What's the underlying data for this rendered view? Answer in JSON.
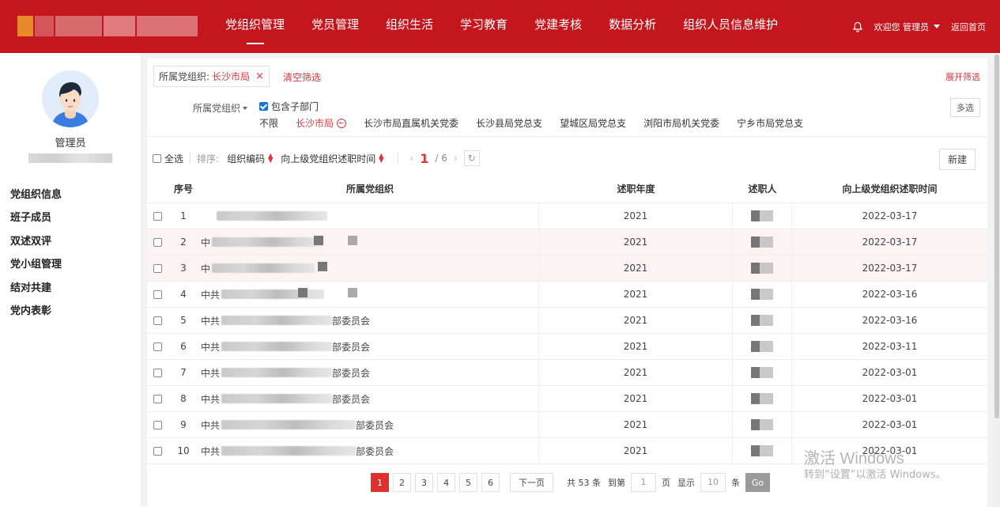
{
  "nav": {
    "items": [
      "党组织管理",
      "党员管理",
      "组织生活",
      "学习教育",
      "党建考核",
      "数据分析",
      "组织人员信息维护"
    ],
    "active_index": 0,
    "welcome": "欢迎您 管理员",
    "home": "返回首页"
  },
  "sidebar": {
    "user_name": "管理员",
    "menu": [
      "党组织信息",
      "班子成员",
      "双述双评",
      "党小组管理",
      "结对共建",
      "党内表彰"
    ]
  },
  "filter": {
    "tag_label": "所属党组织:",
    "tag_value": "长沙市局",
    "tag_close": "×",
    "clear": "清空筛选",
    "expand": "展开筛选",
    "org_label": "所属党组织",
    "include_sub": "包含子部门",
    "options": [
      "不限",
      "长沙市局",
      "长沙市局直属机关党委",
      "长沙县局党总支",
      "望城区局党总支",
      "浏阳市局机关党委",
      "宁乡市局党总支"
    ],
    "selected_option": "长沙市局",
    "multi": "多选"
  },
  "toolbar": {
    "select_all": "全选",
    "sort_label": "排序:",
    "sort_keys": [
      "组织编码",
      "向上级党组织述职时间"
    ],
    "current_page": "1",
    "total_pages": "/ 6",
    "new": "新建"
  },
  "table": {
    "headers": {
      "index": "序号",
      "org": "所属党组织",
      "year": "述职年度",
      "person": "述职人",
      "time": "向上级党组织述职时间"
    },
    "rows": [
      {
        "index": "1",
        "org_prefix": "",
        "org_suffix": "",
        "year": "2021",
        "time": "2022-03-17"
      },
      {
        "index": "2",
        "org_prefix": "中",
        "org_suffix": "",
        "year": "2021",
        "time": "2022-03-17"
      },
      {
        "index": "3",
        "org_prefix": "中",
        "org_suffix": "",
        "year": "2021",
        "time": "2022-03-17"
      },
      {
        "index": "4",
        "org_prefix": "中共",
        "org_suffix": "",
        "year": "2021",
        "time": "2022-03-16"
      },
      {
        "index": "5",
        "org_prefix": "中共",
        "org_suffix": "部委员会",
        "year": "2021",
        "time": "2022-03-16"
      },
      {
        "index": "6",
        "org_prefix": "中共",
        "org_suffix": "部委员会",
        "year": "2021",
        "time": "2022-03-11"
      },
      {
        "index": "7",
        "org_prefix": "中共",
        "org_suffix": "部委员会",
        "year": "2021",
        "time": "2022-03-01"
      },
      {
        "index": "8",
        "org_prefix": "中共",
        "org_suffix": "部委员会",
        "year": "2021",
        "time": "2022-03-01"
      },
      {
        "index": "9",
        "org_prefix": "中共",
        "org_suffix": "部委员会",
        "year": "2021",
        "time": "2022-03-01"
      },
      {
        "index": "10",
        "org_prefix": "中共",
        "org_suffix": "部委员会",
        "year": "2021",
        "time": "2022-03-01"
      }
    ]
  },
  "pagination": {
    "pages": [
      "1",
      "2",
      "3",
      "4",
      "5",
      "6"
    ],
    "active": "1",
    "next": "下一页",
    "total": "共 53 条",
    "goto_label": "到第",
    "goto_value": "1",
    "page_unit": "页",
    "show_label": "显示",
    "page_size": "10",
    "size_unit": "条",
    "go": "Go"
  },
  "watermark": {
    "line1": "激活 Windows",
    "line2": "转到“设置”以激活 Windows。"
  },
  "colors": {
    "brand": "#c4161c",
    "accent": "#d9363e",
    "checkbox": "#1b6fe0"
  }
}
